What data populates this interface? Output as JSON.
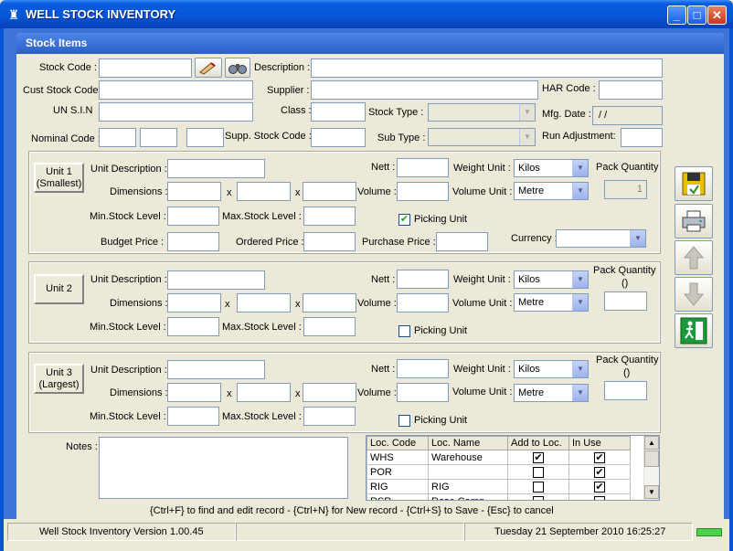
{
  "window": {
    "title": "WELL STOCK INVENTORY",
    "minimize": "_",
    "maximize": "□",
    "close": "✕"
  },
  "panel": {
    "title": "Stock Items"
  },
  "header": {
    "stock_code": "Stock Code :",
    "description": "Description :",
    "cust_stock_code": "Cust Stock Code",
    "supplier": "Supplier :",
    "har_code": "HAR Code :",
    "un_sin": "UN S.I.N",
    "class": "Class :",
    "stock_type": "Stock Type :",
    "mfg_date": "Mfg. Date :",
    "mfg_date_value": " / /",
    "nominal_code": "Nominal Code :",
    "supp_stock_code": "Supp. Stock Code :",
    "sub_type": "Sub Type :",
    "run_adjustment": "Run Adjustment:"
  },
  "labels": {
    "unit_description": "Unit Description :",
    "dimensions": "Dimensions :",
    "x": "x",
    "min_stock": "Min.Stock Level :",
    "max_stock": "Max.Stock Level :",
    "nett": "Nett :",
    "volume": "Volume :",
    "weight_unit": "Weight Unit :",
    "volume_unit": "Volume Unit :",
    "picking_unit": "Picking Unit",
    "budget_price": "Budget Price :",
    "ordered_price": "Ordered Price :",
    "purchase_price": "Purchase Price :",
    "currency": "Currency :"
  },
  "units": [
    {
      "line1": "Unit 1",
      "line2": "(Smallest)",
      "weight_unit": "Kilos",
      "volume_unit": "Metre",
      "pack_label": "Pack Quantity",
      "pack_sub": "",
      "pack_value": "1",
      "picking": true
    },
    {
      "line1": "Unit 2",
      "line2": "",
      "weight_unit": "Kilos",
      "volume_unit": "Metre",
      "pack_label": "Pack Quantity",
      "pack_sub": "()",
      "pack_value": "",
      "picking": false
    },
    {
      "line1": "Unit 3",
      "line2": "(Largest)",
      "weight_unit": "Kilos",
      "volume_unit": "Metre",
      "pack_label": "Pack Quantity",
      "pack_sub": "()",
      "pack_value": "",
      "picking": false
    }
  ],
  "notes_label": "Notes :",
  "locations": {
    "headers": [
      "Loc. Code",
      "Loc. Name",
      "Add to Loc.",
      "In Use"
    ],
    "rows": [
      {
        "code": "WHS",
        "name": "Warehouse",
        "add": true,
        "inuse": true
      },
      {
        "code": "POR",
        "name": "",
        "add": false,
        "inuse": true
      },
      {
        "code": "RIG",
        "name": "RIG",
        "add": false,
        "inuse": true
      },
      {
        "code": "RSR",
        "name": "Rose Camp",
        "add": false,
        "inuse": false
      }
    ]
  },
  "hint": "{Ctrl+F} to find and edit record - {Ctrl+N} for New record - {Ctrl+S} to Save - {Esc} to cancel",
  "status": {
    "version": "Well Stock Inventory  Version 1.00.45",
    "middle": "",
    "datetime": "Tuesday 21 September 2010  16:25:27"
  },
  "colors": {
    "titlebar": "#0655D5",
    "panel_header": "#2B5FC9",
    "indicator": "#4CD24C"
  }
}
